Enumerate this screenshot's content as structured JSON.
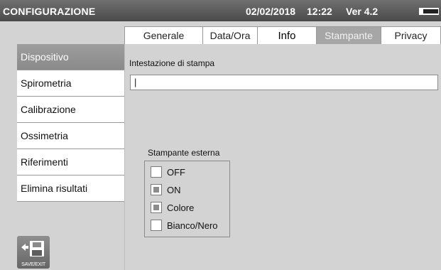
{
  "header": {
    "title": "CONFIGURAZIONE",
    "date": "02/02/2018",
    "time": "12:22",
    "version": "Ver 4.2",
    "battery_icon": "battery-icon"
  },
  "tabs": [
    {
      "label": "Generale"
    },
    {
      "label": "Data/Ora"
    },
    {
      "label": "Info"
    },
    {
      "label": "Stampante",
      "active": true
    },
    {
      "label": "Privacy"
    }
  ],
  "sidebar": {
    "items": [
      {
        "label": "Dispositivo",
        "active": true
      },
      {
        "label": "Spirometria"
      },
      {
        "label": "Calibrazione"
      },
      {
        "label": "Ossimetria"
      },
      {
        "label": "Riferimenti"
      },
      {
        "label": "Elimina risultati"
      }
    ]
  },
  "printer": {
    "header_label": "Intestazione di stampa",
    "header_value": "|",
    "external_label": "Stampante esterna",
    "options": [
      {
        "label": "OFF",
        "checked": false
      },
      {
        "label": "ON",
        "checked": true
      },
      {
        "label": "Colore",
        "checked": true
      },
      {
        "label": "Bianco/Nero",
        "checked": false
      }
    ]
  },
  "save_exit": {
    "label": "SAVE/EXIT",
    "icon": "save-exit-icon"
  },
  "colors": {
    "titlebar": "#4a4a4a",
    "background": "#d3d3d3",
    "active_tab": "#a6a6a6",
    "active_sidebar": "#8a8a8a"
  }
}
